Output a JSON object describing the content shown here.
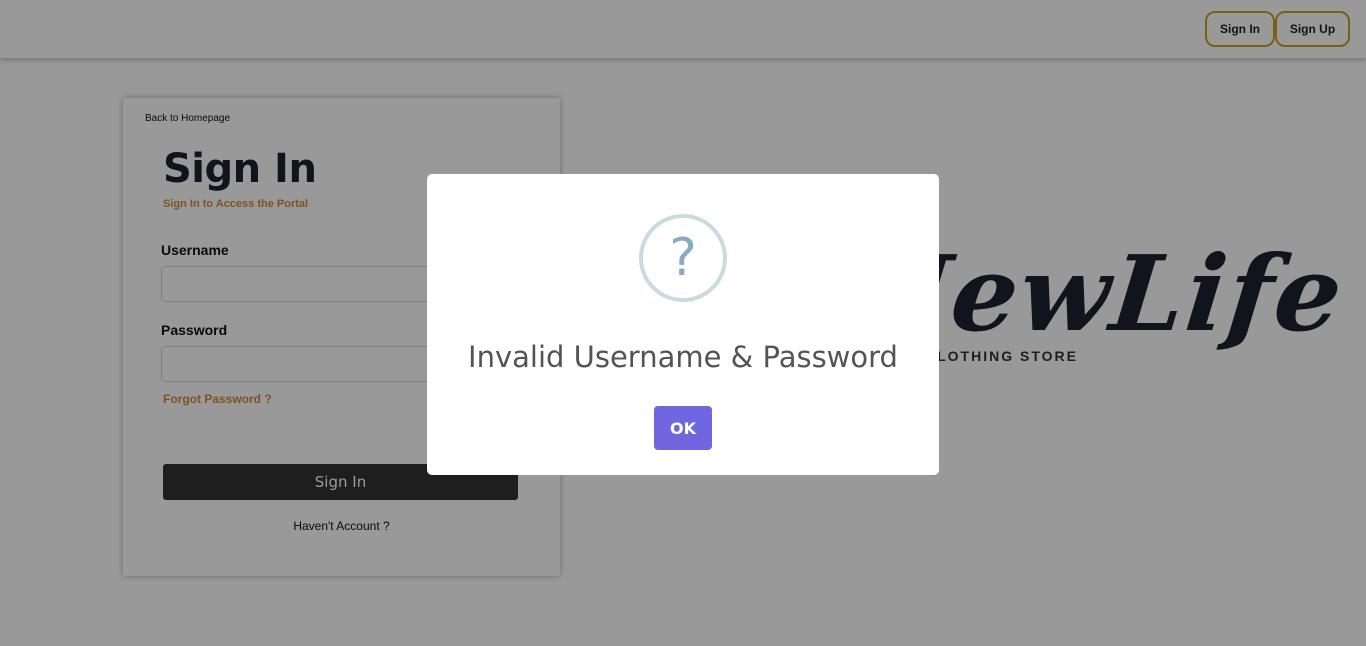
{
  "header": {
    "signin_label": "Sign In",
    "signup_label": "Sign Up"
  },
  "login": {
    "back_link": "Back to Homepage",
    "title": "Sign In",
    "subtitle": "Sign In to Access the Portal",
    "username_label": "Username",
    "username_value": "",
    "password_label": "Password",
    "password_value": "",
    "forgot_label": "Forgot Password ?",
    "submit_label": "Sign In",
    "no_account_label": "Haven't Account ?"
  },
  "logo": {
    "text": "NewLife",
    "subtitle": "CLOTHING STORE"
  },
  "dialog": {
    "icon": "question-icon",
    "icon_glyph": "?",
    "title": "Invalid Username & Password",
    "ok_label": "OK"
  },
  "colors": {
    "accent_gold": "#c9a227",
    "accent_orange": "#d08a3a",
    "dialog_button": "#7066e0",
    "dark_button": "#333333"
  }
}
